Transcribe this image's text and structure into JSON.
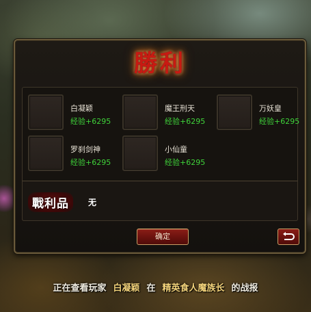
{
  "dialog": {
    "title": "勝利",
    "members": [
      {
        "name": "白凝颖",
        "exp": "经验+6295"
      },
      {
        "name": "魔王刑天",
        "exp": "经验+6295"
      },
      {
        "name": "万妖皇",
        "exp": "经验+6295"
      },
      {
        "name": "罗刹剑神",
        "exp": "经验+6295"
      },
      {
        "name": "小仙童",
        "exp": "经验+6295"
      }
    ],
    "spoils_label": "戰利品",
    "spoils_value": "无",
    "confirm_label": "确定",
    "back_icon": "return-arrow-icon"
  },
  "footer": {
    "prefix": "正在查看玩家",
    "player": "白凝颖",
    "middle": "在",
    "boss": "精英食人魔族长",
    "suffix": "的战报"
  },
  "colors": {
    "title_red": "#c81a12",
    "exp_green": "#3fd33a",
    "highlight_gold": "#f2d27a",
    "button_red": "#6a120e"
  }
}
